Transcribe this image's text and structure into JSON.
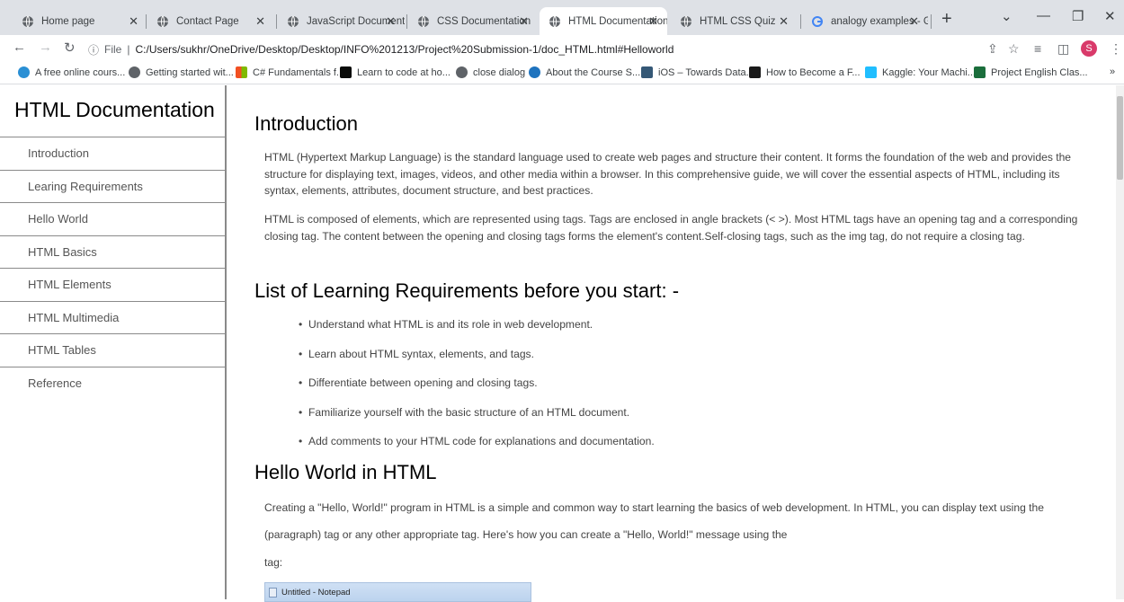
{
  "browser": {
    "tabs": [
      {
        "title": "Home page",
        "active": false
      },
      {
        "title": "Contact Page",
        "active": false
      },
      {
        "title": "JavaScript Documenta",
        "active": false
      },
      {
        "title": "CSS Documentation",
        "active": false
      },
      {
        "title": "HTML Documentation",
        "active": true
      },
      {
        "title": "HTML CSS Quiz",
        "active": false
      },
      {
        "title": "analogy examples - G",
        "active": false
      }
    ],
    "new_tab": "+",
    "address": {
      "scheme_label": "File",
      "url": "C:/Users/sukhr/OneDrive/Desktop/Desktop/INFO%201213/Project%20Submission-1/doc_HTML.html#Helloworld"
    },
    "profile_initial": "S",
    "bookmarks": [
      {
        "label": "A free online cours...",
        "color": "#2a8fd4"
      },
      {
        "label": "Getting started wit...",
        "color": "#5f6368"
      },
      {
        "label": "C# Fundamentals f...",
        "color": "#f25022"
      },
      {
        "label": "Learn to code at ho...",
        "color": "#0a0b09"
      },
      {
        "label": "close dialog",
        "color": "#5f6368"
      },
      {
        "label": "About the Course S...",
        "color": "#1e73be"
      },
      {
        "label": "iOS – Towards Data...",
        "color": "#355876"
      },
      {
        "label": "How to Become a F...",
        "color": "#1a1a1a"
      },
      {
        "label": "Kaggle: Your Machi...",
        "color": "#20beff"
      },
      {
        "label": "Project English Clas...",
        "color": "#1b6e3c"
      }
    ],
    "bookmarks_overflow": "»"
  },
  "sidebar": {
    "title": "HTML Documentation",
    "items": [
      {
        "label": "Introduction"
      },
      {
        "label": "Learing Requirements"
      },
      {
        "label": "Hello World"
      },
      {
        "label": "HTML Basics"
      },
      {
        "label": "HTML Elements"
      },
      {
        "label": "HTML Multimedia"
      },
      {
        "label": "HTML Tables"
      },
      {
        "label": "Reference"
      }
    ]
  },
  "main": {
    "intro": {
      "heading": "Introduction",
      "p1": "HTML (Hypertext Markup Language) is the standard language used to create web pages and structure their content. It forms the foundation of the web and provides the structure for displaying text, images, videos, and other media within a browser. In this comprehensive guide, we will cover the essential aspects of HTML, including its syntax, elements, attributes, document structure, and best practices.",
      "p2": "HTML is composed of elements, which are represented using tags. Tags are enclosed in angle brackets (< >). Most HTML tags have an opening tag and a corresponding closing tag. The content between the opening and closing tags forms the element's content.Self-closing tags, such as the img tag, do not require a closing tag."
    },
    "requirements": {
      "heading": "List of Learning Requirements before you start: -",
      "items": [
        "Understand what HTML is and its role in web development.",
        "Learn about HTML syntax, elements, and tags.",
        "Differentiate between opening and closing tags.",
        "Familiarize yourself with the basic structure of an HTML document.",
        "Add comments to your HTML code for explanations and documentation."
      ]
    },
    "hello": {
      "heading": "Hello World in HTML",
      "p1": "Creating a \"Hello, World!\" program in HTML is a simple and common way to start learning the basics of web development. In HTML, you can display text using the",
      "p2": "(paragraph) tag or any other appropriate tag. Here's how you can create a \"Hello, World!\" message using the",
      "p3": "tag:",
      "screenshot_title": "Untitled - Notepad"
    }
  }
}
